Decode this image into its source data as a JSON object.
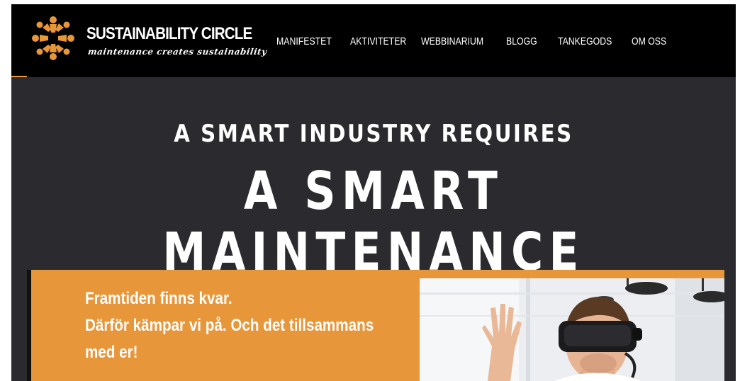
{
  "brand": {
    "name": "SUSTAINABILITY CIRCLE",
    "tagline": "maintenance creates sustainability",
    "accent_color": "#e8963a",
    "logo_icon": "people-circle-icon"
  },
  "nav": {
    "items": [
      {
        "label": "MANIFESTET"
      },
      {
        "label": "AKTIVITETER"
      },
      {
        "label": "WEBBINARIUM"
      },
      {
        "label": "BLOGG"
      },
      {
        "label": "TANKEGODS"
      },
      {
        "label": "OM OSS"
      }
    ]
  },
  "hero": {
    "line1": "A SMART INDUSTRY REQUIRES",
    "line2": "A SMART MAINTENANCE",
    "background": "#2b2a2e"
  },
  "promo": {
    "lines": [
      "Framtiden finns kvar.",
      "Därför kämpar vi på. Och det tillsammans",
      "med er!"
    ],
    "background": "#e8963a",
    "image": "vr-headset-person-photo"
  }
}
